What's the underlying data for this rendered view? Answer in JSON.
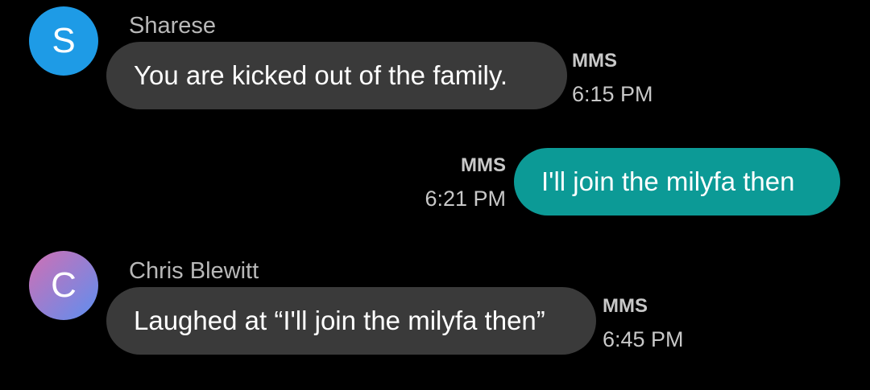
{
  "colors": {
    "background": "#000000",
    "incoming_bubble": "#3a3a3a",
    "outgoing_bubble": "#0c9a96",
    "avatar_sharese": "#1e9be6",
    "avatar_chris_start": "#d16fb3",
    "avatar_chris_end": "#5d8ff0"
  },
  "messages": [
    {
      "direction": "incoming",
      "sender": "Sharese",
      "avatar_letter": "S",
      "text": "You are kicked out of the family.",
      "type": "MMS",
      "time": "6:15 PM"
    },
    {
      "direction": "outgoing",
      "text": "I'll join the milyfa then",
      "type": "MMS",
      "time": "6:21 PM"
    },
    {
      "direction": "incoming",
      "sender": "Chris Blewitt",
      "avatar_letter": "C",
      "text": "Laughed at “I'll join the milyfa then”",
      "type": "MMS",
      "time": "6:45 PM"
    }
  ]
}
